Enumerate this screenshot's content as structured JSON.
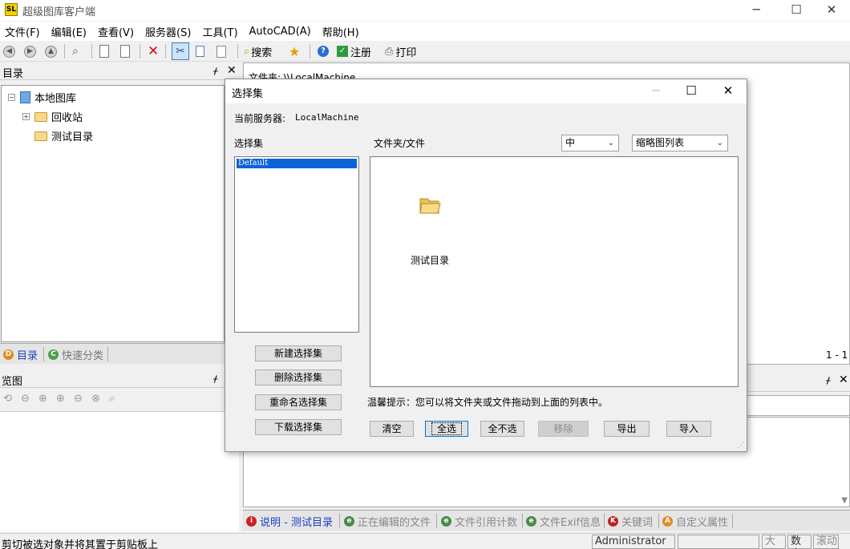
{
  "window": {
    "title": "超级图库客户端",
    "logo": "SL",
    "controls": [
      "minimize-icon",
      "maximize-icon",
      "close-icon"
    ]
  },
  "menu": [
    "文件(F)",
    "编辑(E)",
    "查看(V)",
    "服务器(S)",
    "工具(T)",
    "AutoCAD(A)",
    "帮助(H)"
  ],
  "toolbar": {
    "search": "搜索",
    "register": "注册",
    "print": "打印"
  },
  "left_panel": {
    "dir_title": "目录",
    "tree": {
      "root": "本地图库",
      "children": [
        "回收站",
        "测试目录"
      ]
    },
    "tabs": [
      "目录",
      "快速分类"
    ],
    "preview_title": "览图"
  },
  "main": {
    "path_label": "文件夹: \\\\LocalMachine",
    "page_indicator": "1 - 1",
    "bottom_tabs": [
      "说明 - 测试目录",
      "正在编辑的文件",
      "文件引用计数",
      "文件Exif信息",
      "关键词",
      "自定义属性"
    ]
  },
  "statusbar": {
    "text": "剪切被选对象并将其置于剪贴板上",
    "user": "Administrator",
    "caps": "大写",
    "num": "数字",
    "scroll": "滚动"
  },
  "dialog": {
    "title": "选择集",
    "server_label": "当前服务器:",
    "server_value": "LocalMachine",
    "sets_label": "选择集",
    "files_label": "文件夹/文件",
    "size_select": "中",
    "view_select": "缩略图列表",
    "sets": [
      "Default"
    ],
    "files": [
      {
        "name": "测试目录",
        "icon": "folder-icon"
      }
    ],
    "set_buttons": [
      "新建选择集",
      "删除选择集",
      "重命名选择集",
      "下载选择集"
    ],
    "hint": "温馨提示：您可以将文件夹或文件拖动到上面的列表中。",
    "action_buttons": {
      "clear": "清空",
      "select_all": "全选",
      "select_none": "全不选",
      "remove": "移除",
      "export": "导出",
      "import": "导入"
    }
  }
}
